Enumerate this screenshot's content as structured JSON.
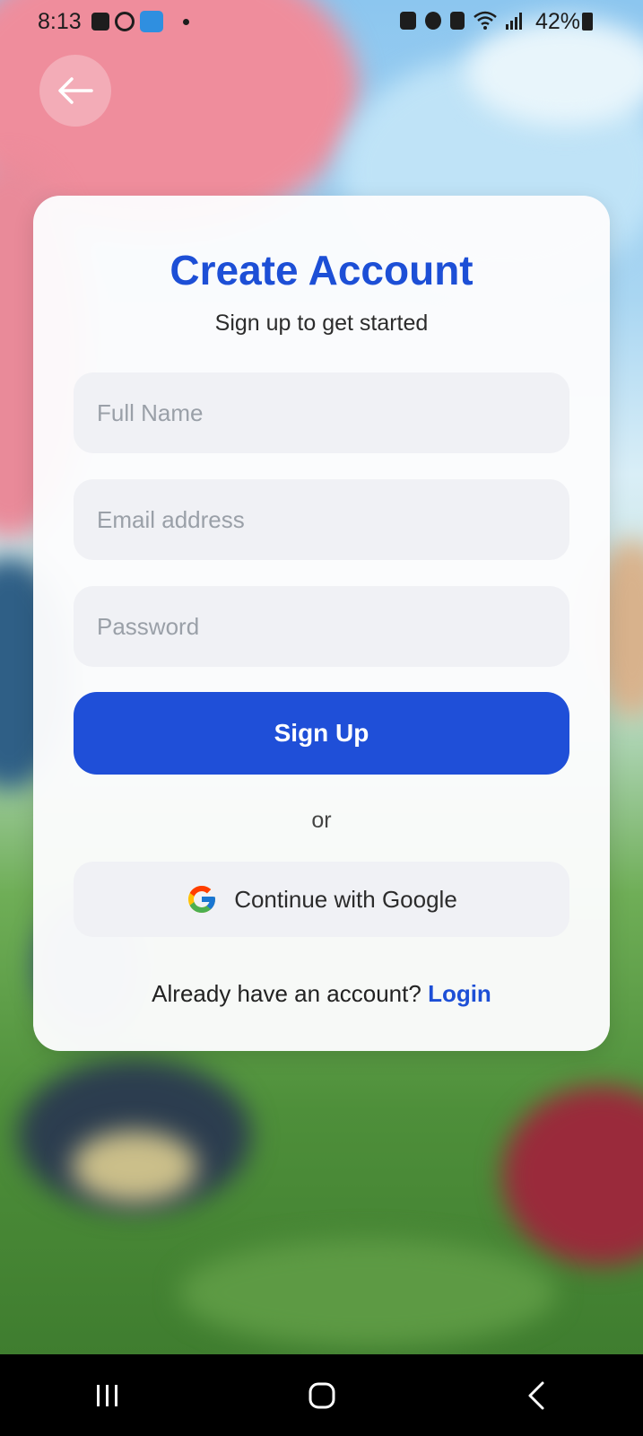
{
  "status_bar": {
    "time": "8:13",
    "battery": "42%"
  },
  "back_button": {
    "icon": "arrow-left-icon"
  },
  "card": {
    "title": "Create Account",
    "subtitle": "Sign up to get started",
    "full_name": {
      "placeholder": "Full Name",
      "value": ""
    },
    "email": {
      "placeholder": "Email address",
      "value": ""
    },
    "password": {
      "placeholder": "Password",
      "value": ""
    },
    "signup_label": "Sign Up",
    "or_label": "or",
    "google_label": "Continue with Google",
    "login_prompt": "Already have an account?",
    "login_link": "Login"
  },
  "colors": {
    "accent": "#1f4fd8",
    "title": "#1d4fd6",
    "field_bg": "#f0f1f5"
  },
  "nav_bar": {
    "recents_icon": "recents-icon",
    "home_icon": "home-icon",
    "back_icon": "back-chevron-icon"
  }
}
